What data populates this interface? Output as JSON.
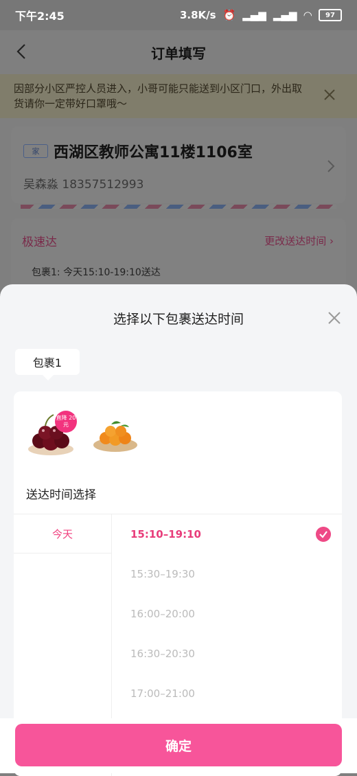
{
  "status_bar": {
    "time": "下午2:45",
    "speed": "3.8K/s",
    "battery": "97"
  },
  "header": {
    "title": "订单填写"
  },
  "notice": {
    "text": "因部分小区严控人员进入，小哥可能只能送到小区门口，外出取货请你一定带好口罩哦～"
  },
  "address": {
    "tag": "家",
    "line": "西湖区教师公寓11楼1106室",
    "contact": "吴森淼 18357512993"
  },
  "shipping": {
    "title": "极速达",
    "change_label": "更改送达时间 ›",
    "package_line": "包裹1:  今天15:10-19:10送达"
  },
  "sheet": {
    "title": "选择以下包裹送达时间",
    "package_tab": "包裹1",
    "badge": "直降 20元",
    "delivery_label": "送达时间选择",
    "days": [
      "今天"
    ],
    "slots": [
      "15:10–19:10",
      "15:30–19:30",
      "16:00–20:00",
      "16:30–20:30",
      "17:00–21:00"
    ],
    "selected_slot": 0,
    "confirm_label": "确定"
  },
  "colors": {
    "accent": "#f7559a",
    "selected": "#e83c7a"
  }
}
